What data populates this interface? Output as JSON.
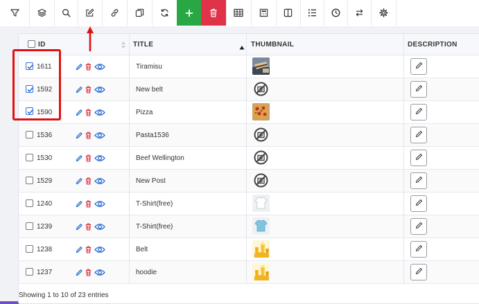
{
  "toolbar": {
    "buttons": [
      {
        "name": "filter-button",
        "icon": "filter-icon"
      },
      {
        "name": "layers-button",
        "icon": "layers-icon"
      },
      {
        "name": "search-button",
        "icon": "search-icon"
      },
      {
        "name": "bulk-edit-button",
        "icon": "edit-icon"
      },
      {
        "name": "link-button",
        "icon": "link-icon"
      },
      {
        "name": "duplicate-button",
        "icon": "copy-icon"
      },
      {
        "name": "refresh-button",
        "icon": "refresh-icon"
      },
      {
        "name": "add-button",
        "icon": "plus-icon"
      },
      {
        "name": "delete-button",
        "icon": "trash-icon"
      },
      {
        "name": "table-button",
        "icon": "table-icon"
      },
      {
        "name": "calculator-button",
        "icon": "calculator-icon"
      },
      {
        "name": "columns-button",
        "icon": "columns-icon"
      },
      {
        "name": "list-button",
        "icon": "list-icon"
      },
      {
        "name": "history-button",
        "icon": "clock-icon"
      },
      {
        "name": "swap-button",
        "icon": "swap-icon"
      },
      {
        "name": "settings-button",
        "icon": "gear-icon"
      }
    ],
    "colors": {
      "add": "#27a844",
      "delete": "#e0334a"
    }
  },
  "table": {
    "columns": {
      "id": "ID",
      "title": "TITLE",
      "thumbnail": "THUMBNAIL",
      "description": "DESCRIPTION"
    },
    "sort": {
      "column": "title",
      "direction": "asc"
    },
    "rows": [
      {
        "id": "1611",
        "title": "Tiramisu",
        "checked": true,
        "thumb": "food-tiramisu"
      },
      {
        "id": "1592",
        "title": "New belt",
        "checked": true,
        "thumb": "no-image"
      },
      {
        "id": "1590",
        "title": "Pizza",
        "checked": true,
        "thumb": "food-pizza"
      },
      {
        "id": "1536",
        "title": "Pasta1536",
        "checked": false,
        "thumb": "no-image"
      },
      {
        "id": "1530",
        "title": "Beef Wellington",
        "checked": false,
        "thumb": "no-image"
      },
      {
        "id": "1529",
        "title": "New Post",
        "checked": false,
        "thumb": "no-image"
      },
      {
        "id": "1240",
        "title": "T-Shirt(free)",
        "checked": false,
        "thumb": "tshirt-white"
      },
      {
        "id": "1239",
        "title": "T-Shirt(free)",
        "checked": false,
        "thumb": "tshirt-blue"
      },
      {
        "id": "1238",
        "title": "Belt",
        "checked": false,
        "thumb": "drinks-yellow"
      },
      {
        "id": "1237",
        "title": "hoodie",
        "checked": false,
        "thumb": "drinks-yellow"
      }
    ]
  },
  "footer": {
    "info": "Showing 1 to 10 of 23 entries"
  },
  "annotations": {
    "highlight_color": "#e01010"
  }
}
